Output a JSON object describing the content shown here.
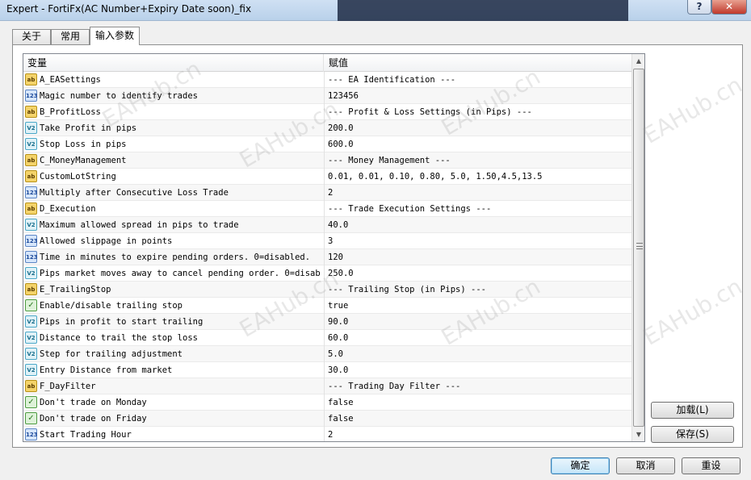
{
  "window": {
    "title": "Expert - FortiFx(AC Number+Expiry Date soon)_fix",
    "help_label": "?",
    "close_label": "✕"
  },
  "tabs": [
    {
      "label": "关于"
    },
    {
      "label": "常用"
    },
    {
      "label": "输入参数"
    }
  ],
  "grid": {
    "header": {
      "variable": "变量",
      "value": "赋值"
    },
    "rows": [
      {
        "icon": "ab",
        "name": "A_EASettings",
        "value": "--- EA Identification ---"
      },
      {
        "icon": "123",
        "name": "Magic number to identify trades",
        "value": "123456"
      },
      {
        "icon": "ab",
        "name": "B_ProfitLoss",
        "value": "--- Profit & Loss Settings (in Pips) ---"
      },
      {
        "icon": "V2",
        "name": "Take Profit in pips",
        "value": "200.0"
      },
      {
        "icon": "V2",
        "name": "Stop Loss in pips",
        "value": "600.0"
      },
      {
        "icon": "ab",
        "name": "C_MoneyManagement",
        "value": "--- Money Management ---"
      },
      {
        "icon": "ab",
        "name": "CustomLotString",
        "value": "0.01, 0.01, 0.10, 0.80, 5.0, 1.50,4.5,13.5"
      },
      {
        "icon": "123",
        "name": "Multiply after Consecutive Loss Trade",
        "value": "2"
      },
      {
        "icon": "ab",
        "name": "D_Execution",
        "value": "--- Trade Execution Settings ---"
      },
      {
        "icon": "V2",
        "name": "Maximum allowed spread in pips to trade",
        "value": "40.0"
      },
      {
        "icon": "123",
        "name": "Allowed slippage in points",
        "value": "3"
      },
      {
        "icon": "123",
        "name": "Time in minutes to expire pending orders. 0=disabled.",
        "value": "120"
      },
      {
        "icon": "V2",
        "name": "Pips market moves away to cancel pending order. 0=disab...",
        "value": "250.0"
      },
      {
        "icon": "ab",
        "name": "E_TrailingStop",
        "value": "--- Trailing Stop (in Pips) ---"
      },
      {
        "icon": "bool",
        "name": "Enable/disable trailing stop",
        "value": "true"
      },
      {
        "icon": "V2",
        "name": "Pips in profit to start trailing",
        "value": "90.0"
      },
      {
        "icon": "V2",
        "name": "Distance to trail the stop loss",
        "value": "60.0"
      },
      {
        "icon": "V2",
        "name": "Step for trailing adjustment",
        "value": "5.0"
      },
      {
        "icon": "V2",
        "name": "Entry Distance from market",
        "value": "30.0"
      },
      {
        "icon": "ab",
        "name": "F_DayFilter",
        "value": "--- Trading Day Filter ---"
      },
      {
        "icon": "bool",
        "name": "Don't trade on Monday",
        "value": "false"
      },
      {
        "icon": "bool",
        "name": "Don't trade on Friday",
        "value": "false"
      },
      {
        "icon": "123",
        "name": "Start Trading Hour",
        "value": "2"
      }
    ]
  },
  "buttons": {
    "load": "加载(L)",
    "save": "保存(S)",
    "ok": "确定",
    "cancel": "取消",
    "reset": "重设"
  },
  "watermark_text": "EAHub.cn"
}
